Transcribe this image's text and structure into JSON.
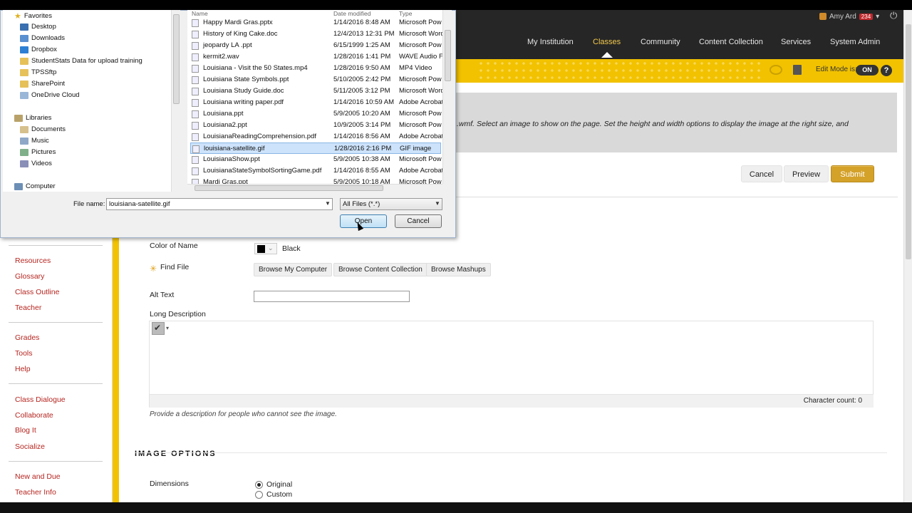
{
  "header": {
    "user_name": "Amy Ard",
    "notification_count": "234",
    "nav": [
      "My Institution",
      "Classes",
      "Community",
      "Content Collection",
      "Services",
      "System Admin"
    ],
    "active_nav": "Classes",
    "edit_mode_label": "Edit Mode is:",
    "edit_mode_value": "ON",
    "help": "?"
  },
  "course_menu": {
    "group1": [
      "Resources",
      "Glossary",
      "Class Outline",
      "Teacher"
    ],
    "group2": [
      "Grades",
      "Tools",
      "Help"
    ],
    "group3": [
      "Class Dialogue",
      "Collaborate",
      "Blog It",
      "Socialize"
    ],
    "group4": [
      "New and Due",
      "Teacher Info"
    ]
  },
  "instructions": {
    "text": ".wmf. Select an image to show on the page. Set the height and width options to display the image at the right size, and"
  },
  "actions": {
    "cancel": "Cancel",
    "preview": "Preview",
    "submit": "Submit"
  },
  "form": {
    "color_of_name_label": "Color of Name",
    "color_value": "Black",
    "find_file_label": "Find File",
    "browse_computer": "Browse My Computer",
    "browse_content": "Browse Content Collection",
    "browse_mashups": "Browse Mashups",
    "alt_text_label": "Alt Text",
    "alt_text_value": "",
    "long_description_label": "Long Description",
    "character_count": "Character count: 0",
    "help_text": "Provide a description for people who cannot see the image.",
    "image_options_title": "IMAGE OPTIONS",
    "dimensions_label": "Dimensions",
    "dimension_options": [
      "Original",
      "Custom"
    ],
    "dimension_selected": "Original"
  },
  "dialog": {
    "nav_items": [
      {
        "label": "Favorites",
        "icon": "star-icon"
      },
      {
        "label": "Desktop",
        "icon": "desktop-icon"
      },
      {
        "label": "Downloads",
        "icon": "downloads-icon"
      },
      {
        "label": "Dropbox",
        "icon": "dropbox-icon"
      },
      {
        "label": "StudentStats Data for upload training",
        "icon": "folder-icon"
      },
      {
        "label": "TPSSftp",
        "icon": "folder-icon"
      },
      {
        "label": "SharePoint",
        "icon": "folder-icon"
      },
      {
        "label": "OneDrive Cloud",
        "icon": "cloud-icon"
      },
      {
        "label": "Libraries",
        "icon": "library-icon"
      },
      {
        "label": "Documents",
        "icon": "documents-icon"
      },
      {
        "label": "Music",
        "icon": "music-icon"
      },
      {
        "label": "Pictures",
        "icon": "pictures-icon"
      },
      {
        "label": "Videos",
        "icon": "videos-icon"
      },
      {
        "label": "Computer",
        "icon": "computer-icon"
      }
    ],
    "columns": [
      "Name",
      "Date modified",
      "Type"
    ],
    "files": [
      {
        "name": "Happy Mardi Gras.pptx",
        "date": "1/14/2016 8:48 AM",
        "type": "Microsoft Pow"
      },
      {
        "name": "History of King Cake.doc",
        "date": "12/4/2013 12:31 PM",
        "type": "Microsoft Word"
      },
      {
        "name": "jeopardy LA .ppt",
        "date": "6/15/1999 1:25 AM",
        "type": "Microsoft Pow"
      },
      {
        "name": "kermit2.wav",
        "date": "1/28/2016 1:41 PM",
        "type": "WAVE Audio Fi"
      },
      {
        "name": "Louisiana - Visit the 50 States.mp4",
        "date": "1/28/2016 9:50 AM",
        "type": "MP4 Video"
      },
      {
        "name": "Louisiana State Symbols.ppt",
        "date": "5/10/2005 2:42 PM",
        "type": "Microsoft Pow"
      },
      {
        "name": "Louisiana Study Guide.doc",
        "date": "5/11/2005 3:12 PM",
        "type": "Microsoft Word"
      },
      {
        "name": "Louisiana writing paper.pdf",
        "date": "1/14/2016 10:59 AM",
        "type": "Adobe Acrobat"
      },
      {
        "name": "Louisiana.ppt",
        "date": "5/9/2005 10:20 AM",
        "type": "Microsoft Pow"
      },
      {
        "name": "Louisiana2.ppt",
        "date": "10/9/2005 3:14 PM",
        "type": "Microsoft Pow"
      },
      {
        "name": "LouisianaReadingComprehension.pdf",
        "date": "1/14/2016 8:56 AM",
        "type": "Adobe Acrobat"
      },
      {
        "name": "louisiana-satellite.gif",
        "date": "1/28/2016 2:16 PM",
        "type": "GIF image"
      },
      {
        "name": "LouisianaShow.ppt",
        "date": "5/9/2005 10:38 AM",
        "type": "Microsoft Pow"
      },
      {
        "name": "LouisianaStateSymbolSortingGame.pdf",
        "date": "1/14/2016 8:55 AM",
        "type": "Adobe Acrobat"
      },
      {
        "name": "Mardi Gras.ppt",
        "date": "5/9/2005 10:18 AM",
        "type": "Microsoft Pow"
      }
    ],
    "selected_file": "louisiana-satellite.gif",
    "file_name_label": "File name:",
    "file_name_value": "louisiana-satellite.gif",
    "file_type_value": "All Files (*.*)",
    "open_button": "Open",
    "cancel_button": "Cancel"
  },
  "colors": {
    "accent_yellow": "#f2c200",
    "submit_gold": "#d4a129",
    "link_red": "#b5251f"
  }
}
